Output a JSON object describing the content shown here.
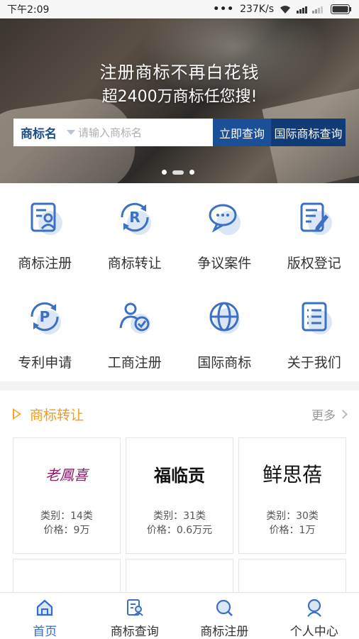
{
  "status_bar": {
    "time": "下午2:09",
    "speed": "237K/s",
    "dots": "•••"
  },
  "banner": {
    "title": "注册商标不再白花钱",
    "subtitle": "超2400万商标任您搜!",
    "search": {
      "type_label": "商标名",
      "placeholder": "请输入商标名",
      "query_button": "立即查询",
      "intl_button": "国际商标查询"
    }
  },
  "services": [
    {
      "label": "商标注册",
      "icon": "trademark-register-icon"
    },
    {
      "label": "商标转让",
      "icon": "trademark-transfer-icon"
    },
    {
      "label": "争议案件",
      "icon": "dispute-case-icon"
    },
    {
      "label": "版权登记",
      "icon": "copyright-register-icon"
    },
    {
      "label": "专利申请",
      "icon": "patent-apply-icon"
    },
    {
      "label": "工商注册",
      "icon": "business-register-icon"
    },
    {
      "label": "国际商标",
      "icon": "global-icon"
    },
    {
      "label": "关于我们",
      "icon": "about-doc-icon"
    }
  ],
  "transfer_section": {
    "title": "商标转让",
    "more": "更多",
    "cards": [
      {
        "logo": "老鳳喜",
        "category": "类别：14类",
        "price": "价格：9万"
      },
      {
        "logo": "福临贡",
        "category": "类别：31类",
        "price": "价格：0.6万元"
      },
      {
        "logo": "鲜思蓓",
        "category": "类别：30类",
        "price": "价格：1万"
      }
    ]
  },
  "bottom_nav": [
    {
      "label": "首页",
      "active": true,
      "icon": "home-icon"
    },
    {
      "label": "商标查询",
      "active": false,
      "icon": "trademark-search-icon"
    },
    {
      "label": "商标注册",
      "active": false,
      "icon": "register-search-icon"
    },
    {
      "label": "个人中心",
      "active": false,
      "icon": "user-center-icon"
    }
  ],
  "colors": {
    "accent": "#2f6bd1",
    "orange": "#f39b1a",
    "navy": "#1b4f96"
  }
}
